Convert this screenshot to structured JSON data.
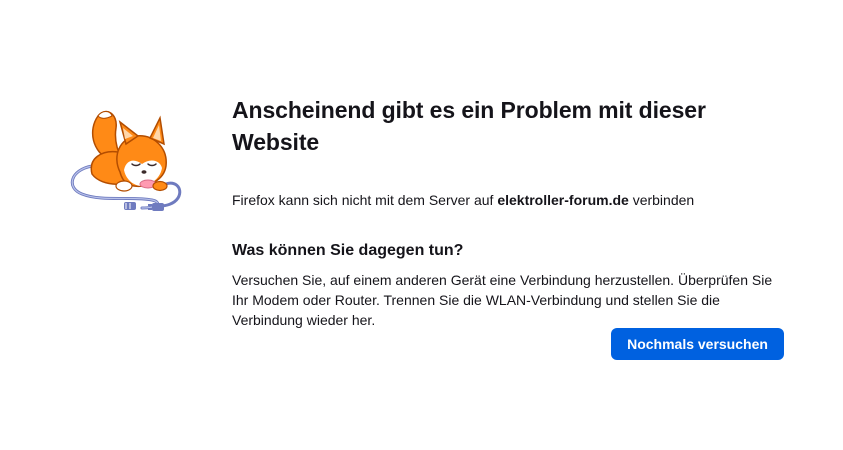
{
  "error_page": {
    "title": "Anscheinend gibt es ein Problem mit dieser Website",
    "description_prefix": "Firefox kann sich nicht mit dem Server auf ",
    "host": "elektroller-forum.de",
    "description_suffix": " verbinden",
    "subtitle": "Was können Sie dagegen tun?",
    "advice": "Versuchen Sie, auf einem anderen Gerät eine Verbindung herzustellen. Überprüfen Sie Ihr Modem oder Router. Trennen Sie die WLAN-Verbindung und stellen Sie die Verbindung wieder her.",
    "retry_label": "Nochmals versuchen",
    "illustration_icon": "fox-unplugged-cable-illustration"
  },
  "colors": {
    "primary_button": "#0061e0",
    "text": "#15141a",
    "fox_orange": "#ff8a16",
    "cable_blue": "#7e8ac9"
  }
}
